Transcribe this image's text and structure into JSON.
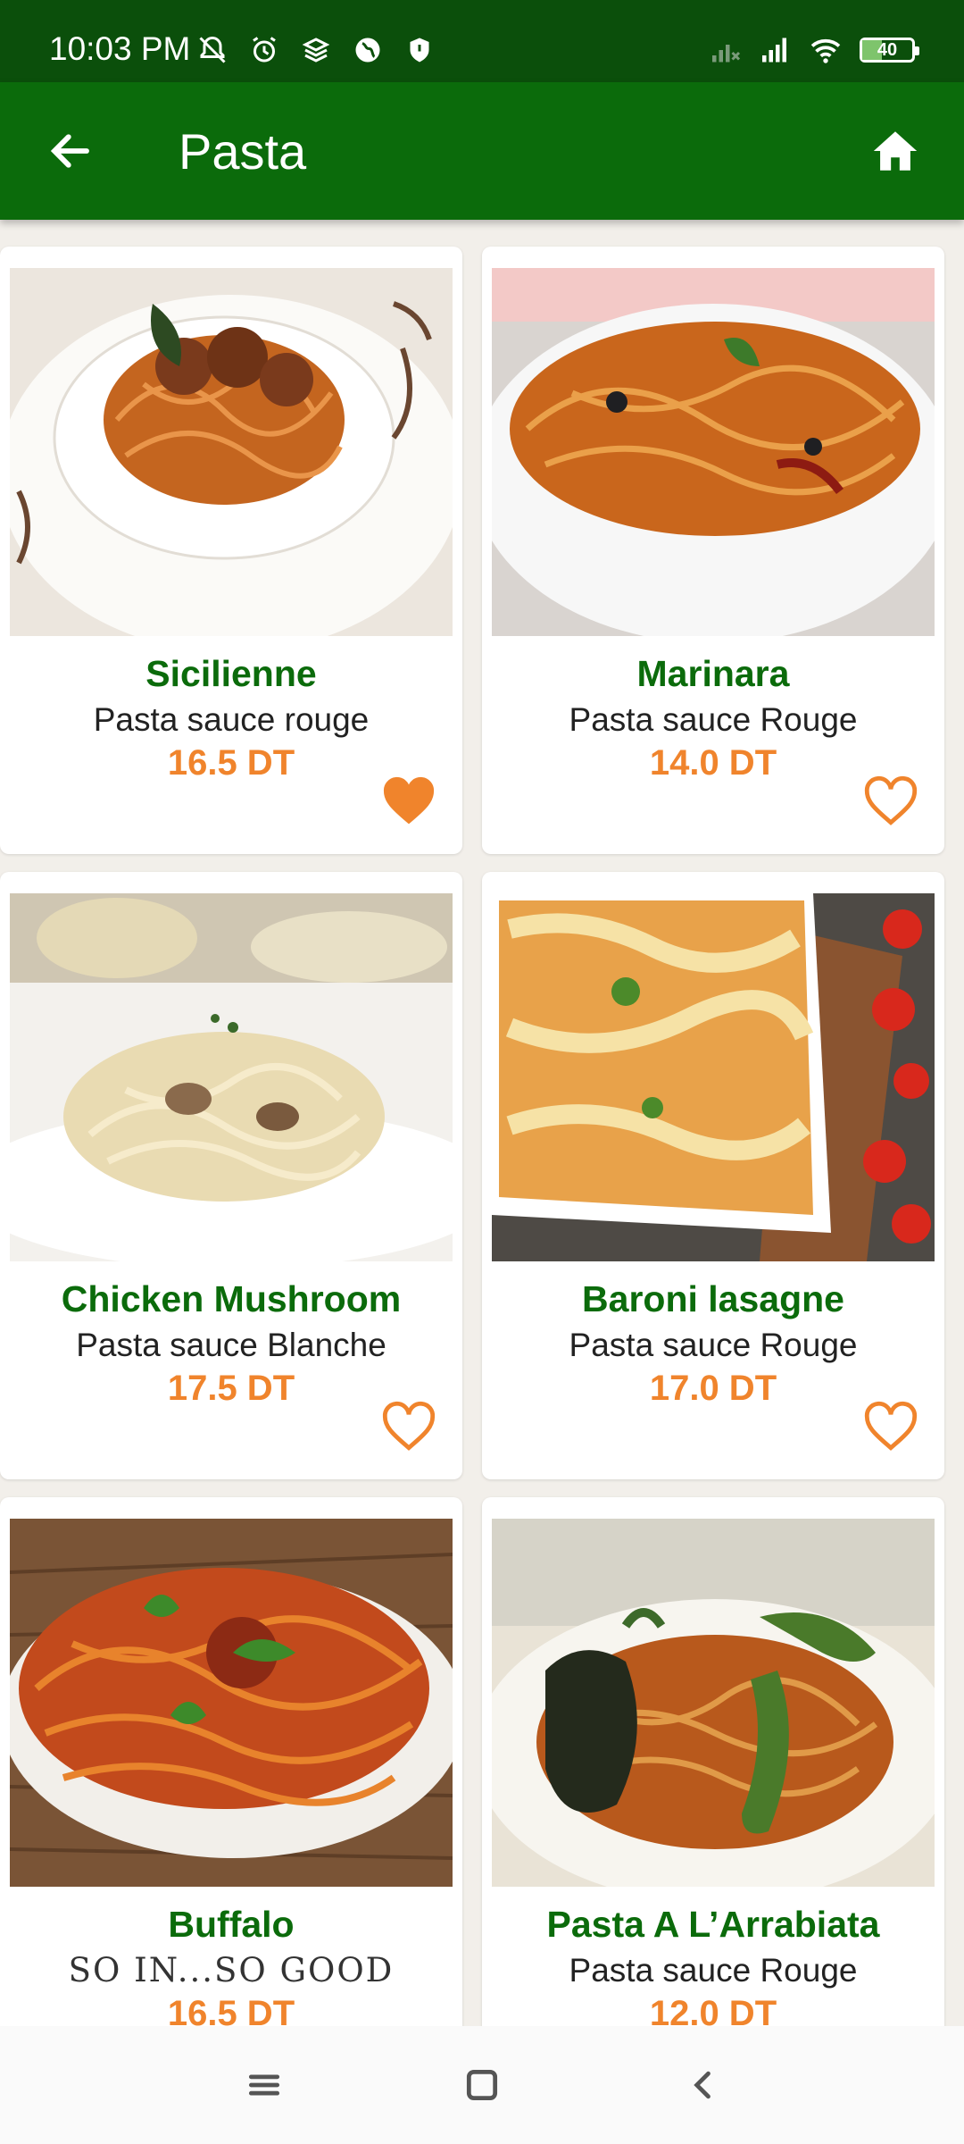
{
  "status": {
    "time": "10:03 PM",
    "battery": "40",
    "battery_level": 0.4,
    "icons_left": [
      "mute-icon",
      "alarm-icon",
      "layers-icon",
      "globe-icon",
      "shield-icon"
    ],
    "icons_right": [
      "no-signal-icon",
      "signal-icon",
      "wifi-icon",
      "battery-icon"
    ]
  },
  "appbar": {
    "title": "Pasta",
    "back_icon": "arrow-back-icon",
    "home_icon": "home-icon"
  },
  "colors": {
    "statusbar": "#0b4f0b",
    "appbar": "#0b6b0b",
    "name": "#0b6b0b",
    "price": "#f0842c",
    "favorite": "#f0842c"
  },
  "items": [
    {
      "name": "Sicilienne",
      "sauce": "Pasta sauce rouge",
      "price": "16.5 DT",
      "favorite": true
    },
    {
      "name": "Marinara",
      "sauce": "Pasta sauce Rouge",
      "price": "14.0 DT",
      "favorite": false
    },
    {
      "name": "Chicken Mushroom",
      "sauce": "Pasta sauce Blanche",
      "price": "17.5 DT",
      "favorite": false
    },
    {
      "name": "Baroni lasagne",
      "sauce": "Pasta sauce Rouge",
      "price": "17.0 DT",
      "favorite": false
    },
    {
      "name": "Buffalo",
      "sauce": "SO IN...SO GOOD",
      "price": "16.5 DT",
      "favorite": false
    },
    {
      "name": "Pasta A L’Arrabiata",
      "sauce": "Pasta sauce Rouge",
      "price": "12.0 DT",
      "favorite": false
    }
  ],
  "navbar": {
    "icons": [
      "menu-icon",
      "home-square-icon",
      "back-chevron-icon"
    ]
  }
}
